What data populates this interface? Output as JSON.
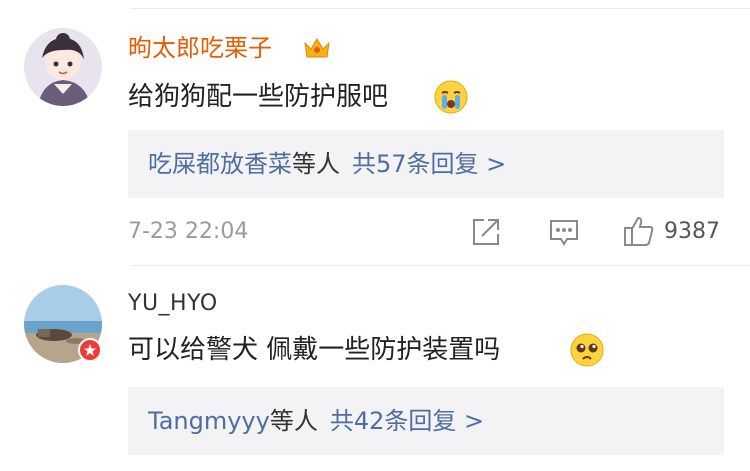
{
  "comments": [
    {
      "username": "昫太郎吃栗子",
      "username_color": "#e85d04",
      "vip_badge_icon": "crown-icon",
      "text": "给狗狗配一些防护服吧",
      "emoji_icon": "crying-emoji-icon",
      "replies": {
        "names": "吃屎都放香菜",
        "suffix": "等人",
        "count_text": "共57条回复 >"
      },
      "time": "7-23 22:04",
      "like_count": "9387"
    },
    {
      "username": "YU_HYO",
      "avatar_badge_icon": "weibo-badge-icon",
      "text": "可以给警犬 佩戴一些防护装置吗",
      "emoji_icon": "pleading-emoji-icon",
      "replies": {
        "names": "Tangmyyy",
        "suffix": "等人",
        "count_text": "共42条回复 >"
      }
    }
  ],
  "colors": {
    "link_blue": "#4e6ea1",
    "reply_bg": "#f3f3f5",
    "meta_gray": "#9b9b9b"
  }
}
